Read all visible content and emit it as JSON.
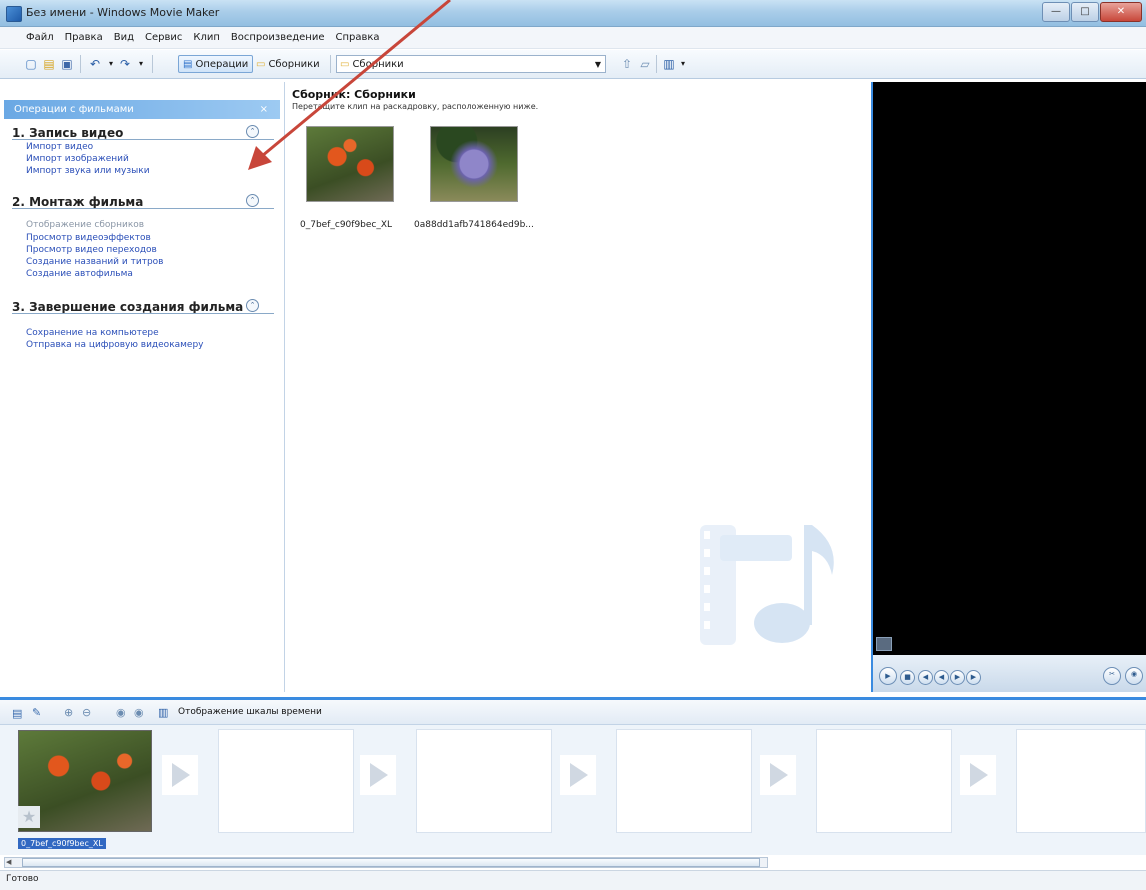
{
  "window": {
    "title": "Без имени - Windows Movie Maker",
    "buttons": {
      "minimize": "—",
      "maximize": "□",
      "close": "✕"
    }
  },
  "menu": [
    "Файл",
    "Правка",
    "Вид",
    "Сервис",
    "Клип",
    "Воспроизведение",
    "Справка"
  ],
  "toolbar": {
    "operations_label": "Операции",
    "collections_label": "Сборники",
    "collections_dropdown_value": "Сборники"
  },
  "task_pane": {
    "header": "Операции с фильмами",
    "close_glyph": "×",
    "sections": [
      {
        "title": "1. Запись видео",
        "links": [
          "Импорт видео",
          "Импорт изображений",
          "Импорт звука или музыки"
        ],
        "dim": []
      },
      {
        "title": "2. Монтаж фильма",
        "links": [
          "Отображение сборников",
          "Просмотр видеоэффектов",
          "Просмотр видео переходов",
          "Создание названий и титров",
          "Создание автофильма"
        ],
        "dim": [
          0
        ]
      },
      {
        "title": "3. Завершение создания фильма",
        "links": [
          "Сохранение на компьютере",
          "Отправка на цифровую видеокамеру"
        ],
        "dim": []
      }
    ]
  },
  "collection": {
    "title": "Сборник: Сборники",
    "subtitle": "Перетащите клип на раскадровку, расположенную ниже.",
    "clips": [
      {
        "label": "0_7bef_c90f9bec_XL"
      },
      {
        "label": "0a88dd1afb741864ed9b..."
      }
    ]
  },
  "storyboard": {
    "toolbar_text": "Отображение шкалы времени",
    "first_clip_label": "0_7bef_c90f9bec_XL"
  },
  "status": {
    "text": "Готово"
  },
  "colors": {
    "accent": "#3a8be0",
    "link": "#2b4fb8",
    "annotation_arrow": "#c8463a"
  }
}
